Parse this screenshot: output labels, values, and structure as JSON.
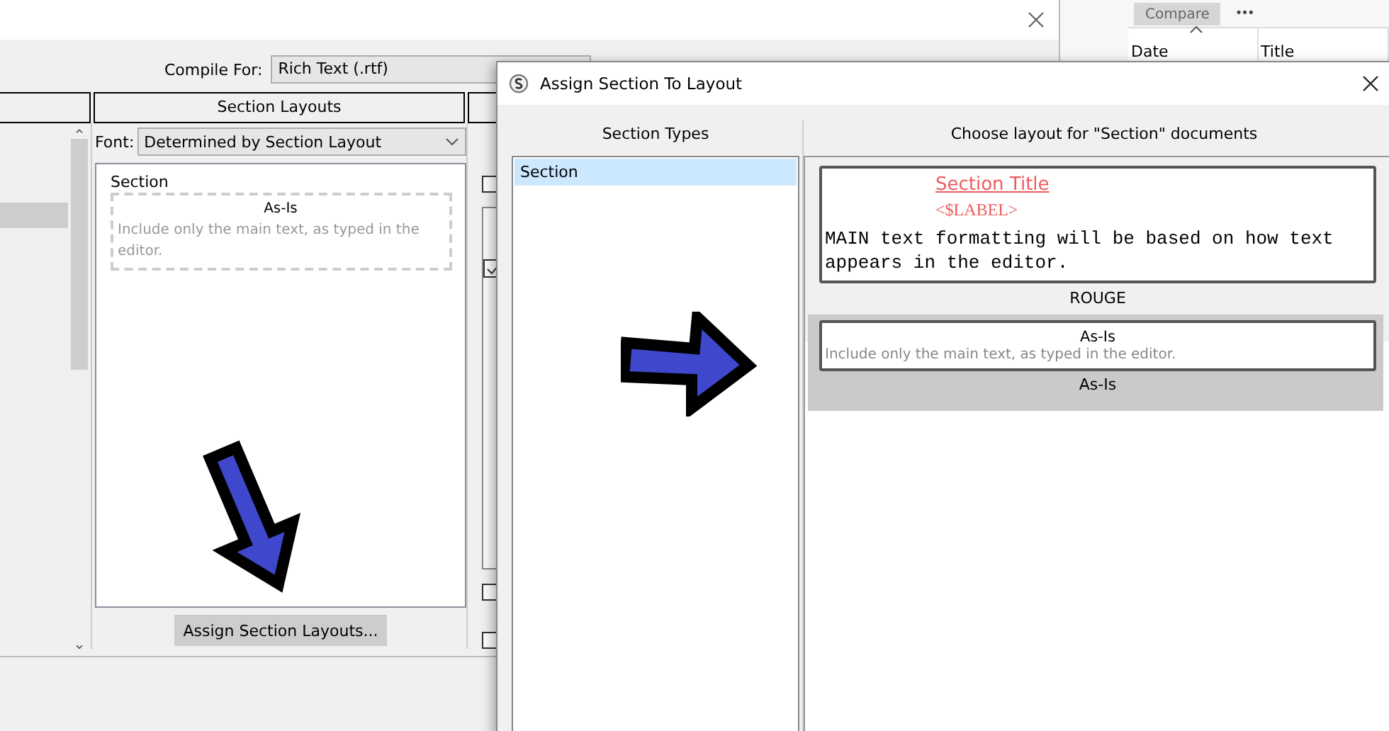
{
  "compile_window": {
    "compile_for": {
      "label": "Compile For:",
      "value": "Rich Text (.rtf)"
    },
    "section_layouts_header": "Section Layouts",
    "font": {
      "label": "Font:",
      "value": "Determined by Section Layout"
    },
    "preview": {
      "heading": "Section",
      "layout_name": "As-Is",
      "description": "Include only the main text, as typed in the editor."
    },
    "assign_button": "Assign Section Layouts...",
    "checkboxes": [
      {
        "checked": false
      },
      {
        "checked": true
      },
      {
        "checked": false
      },
      {
        "checked": false
      }
    ]
  },
  "history_panel": {
    "buttons": [
      "Compare",
      "•••"
    ],
    "columns": [
      "Date",
      "Title"
    ]
  },
  "dialog": {
    "title": "Assign Section To Layout",
    "section_types_header": "Section Types",
    "layouts_header": "Choose layout for \"Section\" documents",
    "section_types": [
      {
        "label": "Section",
        "selected": true
      }
    ],
    "layouts": [
      {
        "kind": "styled",
        "name": "ROUGE",
        "selected": false,
        "title": "Section Title",
        "label": "<$LABEL>",
        "body": "MAIN text formatting will be based on how text appears in the editor."
      },
      {
        "kind": "summary",
        "name": "As-Is",
        "selected": true,
        "title": "As-Is",
        "description": "Include only the main text, as typed in the editor."
      }
    ]
  }
}
